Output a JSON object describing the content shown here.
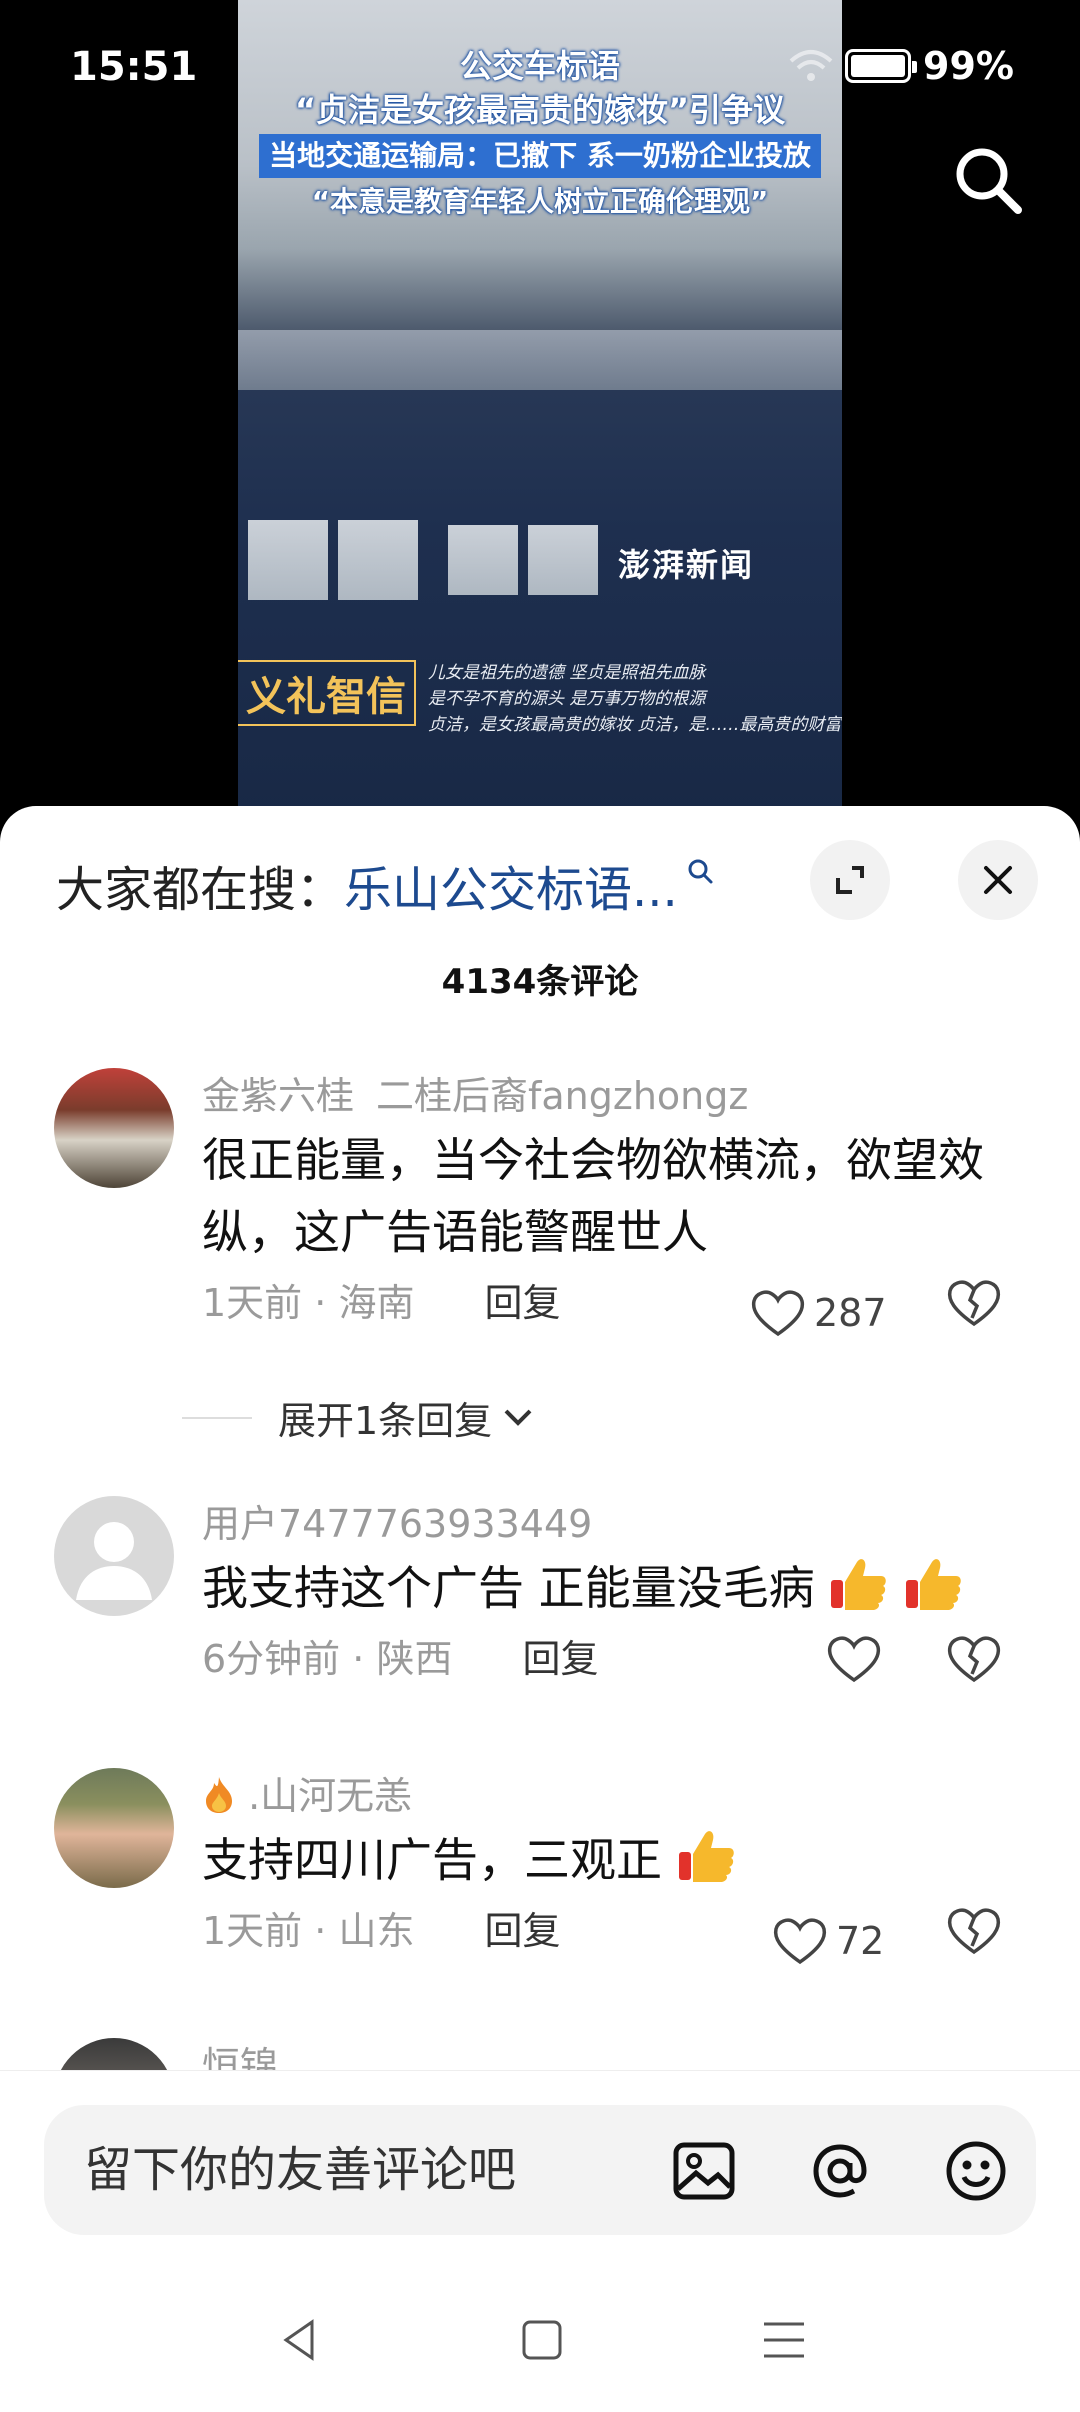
{
  "status": {
    "time": "15:51",
    "battery": "99%"
  },
  "video": {
    "headline": [
      "公交车标语",
      "“贞洁是女孩最高贵的嫁妆”引争议",
      "当地交通运输局：已撤下 系一奶粉企业投放",
      "“本意是教育年轻人树立正确伦理观”"
    ],
    "watermark": "澎湃新闻",
    "bus_slogan": "义礼智信",
    "bus_poem": [
      "儿女是祖先的遗德   坚贞是照祖先血脉",
      "是不孕不育的源头   是万事万物的根源",
      "贞洁，是女孩最高贵的嫁妆   贞洁，是……最高贵的财富"
    ]
  },
  "sheet": {
    "search_label": "大家都在搜：",
    "search_term": "乐山公交标语...",
    "comment_count": "4134条评论"
  },
  "comments": [
    {
      "user": "金紫六桂",
      "user_extra": "二桂后裔fangzhongz",
      "text": "很正能量，当今社会物欲横流，欲望效纵，这广告语能警醒世人",
      "time": "1天前",
      "location": "海南",
      "reply": "回复",
      "likes": "287",
      "expand": "展开1条回复"
    },
    {
      "user": "用户7477763933449",
      "text": "我支持这个广告 正能量没毛病",
      "time": "6分钟前",
      "location": "陕西",
      "reply": "回复",
      "likes": ""
    },
    {
      "user": ".山河无恙",
      "text": "支持四川广告，三观正",
      "time": "1天前",
      "location": "山东",
      "reply": "回复",
      "likes": "72"
    },
    {
      "user": "恒锦"
    }
  ],
  "input": {
    "placeholder": "留下你的友善评论吧"
  },
  "icons": {
    "search": "search-icon",
    "expand": "expand-icon",
    "close": "close-icon",
    "like": "heart-icon",
    "dislike": "broken-heart-icon",
    "image": "image-icon",
    "mention": "at-icon",
    "emoji": "emoji-icon",
    "nav_back": "back-triangle-icon",
    "nav_home": "home-square-icon",
    "nav_menu": "menu-lines-icon"
  },
  "colors": {
    "accent_link": "#1d4a8f",
    "meta_gray": "#9a9a9a",
    "headline_highlight": "#2e6fd0"
  }
}
